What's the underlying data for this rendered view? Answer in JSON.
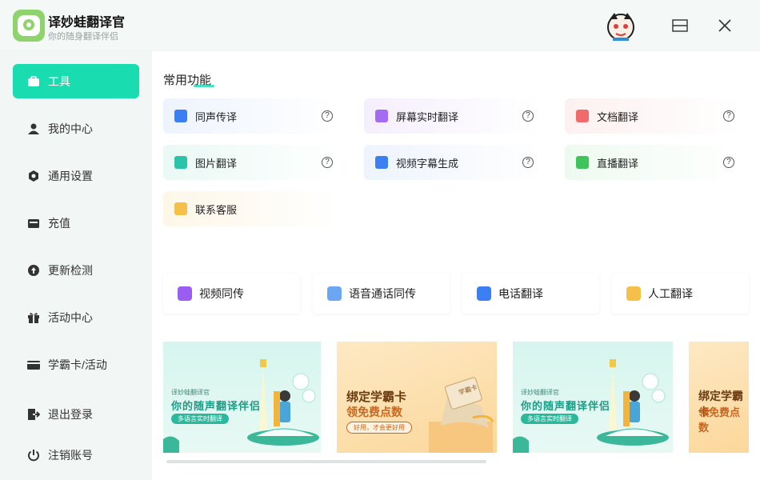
{
  "app": {
    "title": "译妙蛙翻译官",
    "subtitle": "你的随身翻译伴侣",
    "accent": "#19dcb0"
  },
  "window": {
    "maximize_icon": "maximize-icon",
    "close_icon": "close-icon"
  },
  "sidebar": {
    "items": [
      {
        "label": "工具",
        "icon": "toolbox-icon",
        "active": true
      },
      {
        "label": "我的中心",
        "icon": "user-icon"
      },
      {
        "label": "通用设置",
        "icon": "gear-icon"
      },
      {
        "label": "充值",
        "icon": "wallet-icon"
      },
      {
        "label": "更新检测",
        "icon": "upload-icon"
      },
      {
        "label": "活动中心",
        "icon": "gift-icon"
      },
      {
        "label": "学霸卡/活动",
        "icon": "card-icon"
      },
      {
        "label": "退出登录",
        "icon": "logout-icon"
      },
      {
        "label": "注销账号",
        "icon": "power-icon"
      }
    ]
  },
  "main": {
    "section_title": "常用功能",
    "features": [
      {
        "label": "同声传译",
        "icon": "simultaneous-icon",
        "color": "#3b7ff2",
        "help": "?"
      },
      {
        "label": "屏幕实时翻译",
        "icon": "screen-icon",
        "color": "#a46cf0",
        "help": "?"
      },
      {
        "label": "文档翻译",
        "icon": "document-icon",
        "color": "#f06b6b",
        "help": "?"
      },
      {
        "label": "图片翻译",
        "icon": "image-icon",
        "color": "#2bc4a8",
        "help": "?"
      },
      {
        "label": "视频字幕生成",
        "icon": "video-subtitle-icon",
        "color": "#3b7ff2",
        "help": "?"
      },
      {
        "label": "直播翻译",
        "icon": "live-icon",
        "color": "#3ec45a",
        "help": "?"
      },
      {
        "label": "联系客服",
        "icon": "support-icon",
        "color": "#f5c04a"
      }
    ],
    "quick": [
      {
        "label": "视频同传",
        "icon": "video-play-icon",
        "color": "#9b5cf2"
      },
      {
        "label": "语音通话同传",
        "icon": "voice-call-icon",
        "color": "#6aa6f2"
      },
      {
        "label": "电话翻译",
        "icon": "phone-icon",
        "color": "#3b7ff2"
      },
      {
        "label": "人工翻译",
        "icon": "human-translator-icon",
        "color": "#f5c04a"
      }
    ],
    "banners": [
      {
        "type": "green",
        "small": "译妙蛙翻译官",
        "main": "你的随声翻译伴侣",
        "pill": "多语言实时翻译"
      },
      {
        "type": "orange",
        "main1": "绑定学霸卡",
        "main2": "领免费点数",
        "pill": "好用，才会更好用",
        "card": "学霸卡"
      },
      {
        "type": "green",
        "small": "译妙蛙翻译官",
        "main": "你的随声翻译伴侣",
        "pill": "多语言实时翻译"
      },
      {
        "type": "orange",
        "main1": "绑定学霸卡",
        "main2": "领免费点数"
      }
    ]
  }
}
